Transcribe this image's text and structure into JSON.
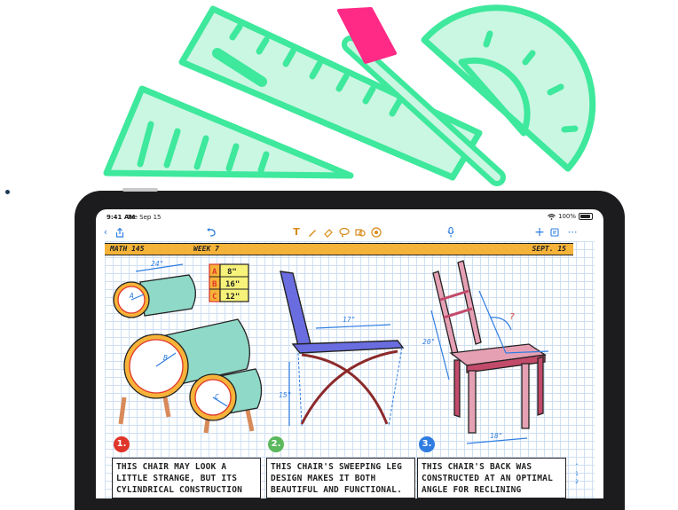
{
  "statusbar": {
    "time": "9:41 AM",
    "date": "Tue Sep 15",
    "battery": "100%"
  },
  "toolbar": {
    "back_icon": "chevron-left-icon",
    "share_icon": "share-icon",
    "undo_icon": "undo-icon",
    "text_icon": "T",
    "tools": [
      "pen-icon",
      "eraser-icon",
      "lasso-icon",
      "shapes-icon",
      "favorites-icon"
    ],
    "mic_icon": "microphone-icon",
    "add_icon": "plus-icon",
    "more_icon": "more-icon",
    "accent": "#d88a1a",
    "blue": "#2f7de1"
  },
  "note": {
    "header_left": "MATH 145",
    "header_mid": "WEEK 7",
    "header_right": "SEPT. 15",
    "header_color": "#f6b339",
    "table": [
      {
        "label": "A",
        "value": "8\""
      },
      {
        "label": "B",
        "value": "16\""
      },
      {
        "label": "C",
        "value": "12\""
      }
    ],
    "chair1": {
      "dim": "24\"",
      "labels": [
        "A",
        "B",
        "C"
      ]
    },
    "chair2": {
      "dim_top": "17\"",
      "dim_side": "15\""
    },
    "chair3": {
      "dim_side": "20\"",
      "dim_bottom": "18\"",
      "angle": "?"
    },
    "captions": [
      {
        "num": "1.",
        "color": "#e0352b",
        "text": "THIS CHAIR MAY LOOK A LITTLE STRANGE, BUT ITS CYLINDRICAL CONSTRUCTION IS"
      },
      {
        "num": "2.",
        "color": "#5cb85c",
        "text": "THIS CHAIR'S SWEEPING LEG DESIGN MAKES IT BOTH BEAUTIFUL AND FUNCTIONAL."
      },
      {
        "num": "3.",
        "color": "#2f7de1",
        "text": "THIS CHAIR'S BACK WAS CONSTRUCTED AT AN OPTIMAL ANGLE FOR RECLINING"
      }
    ],
    "pages": [
      "1",
      "2"
    ]
  },
  "illustration": {
    "green": "#3ee89c",
    "pink": "#ff2a86"
  }
}
